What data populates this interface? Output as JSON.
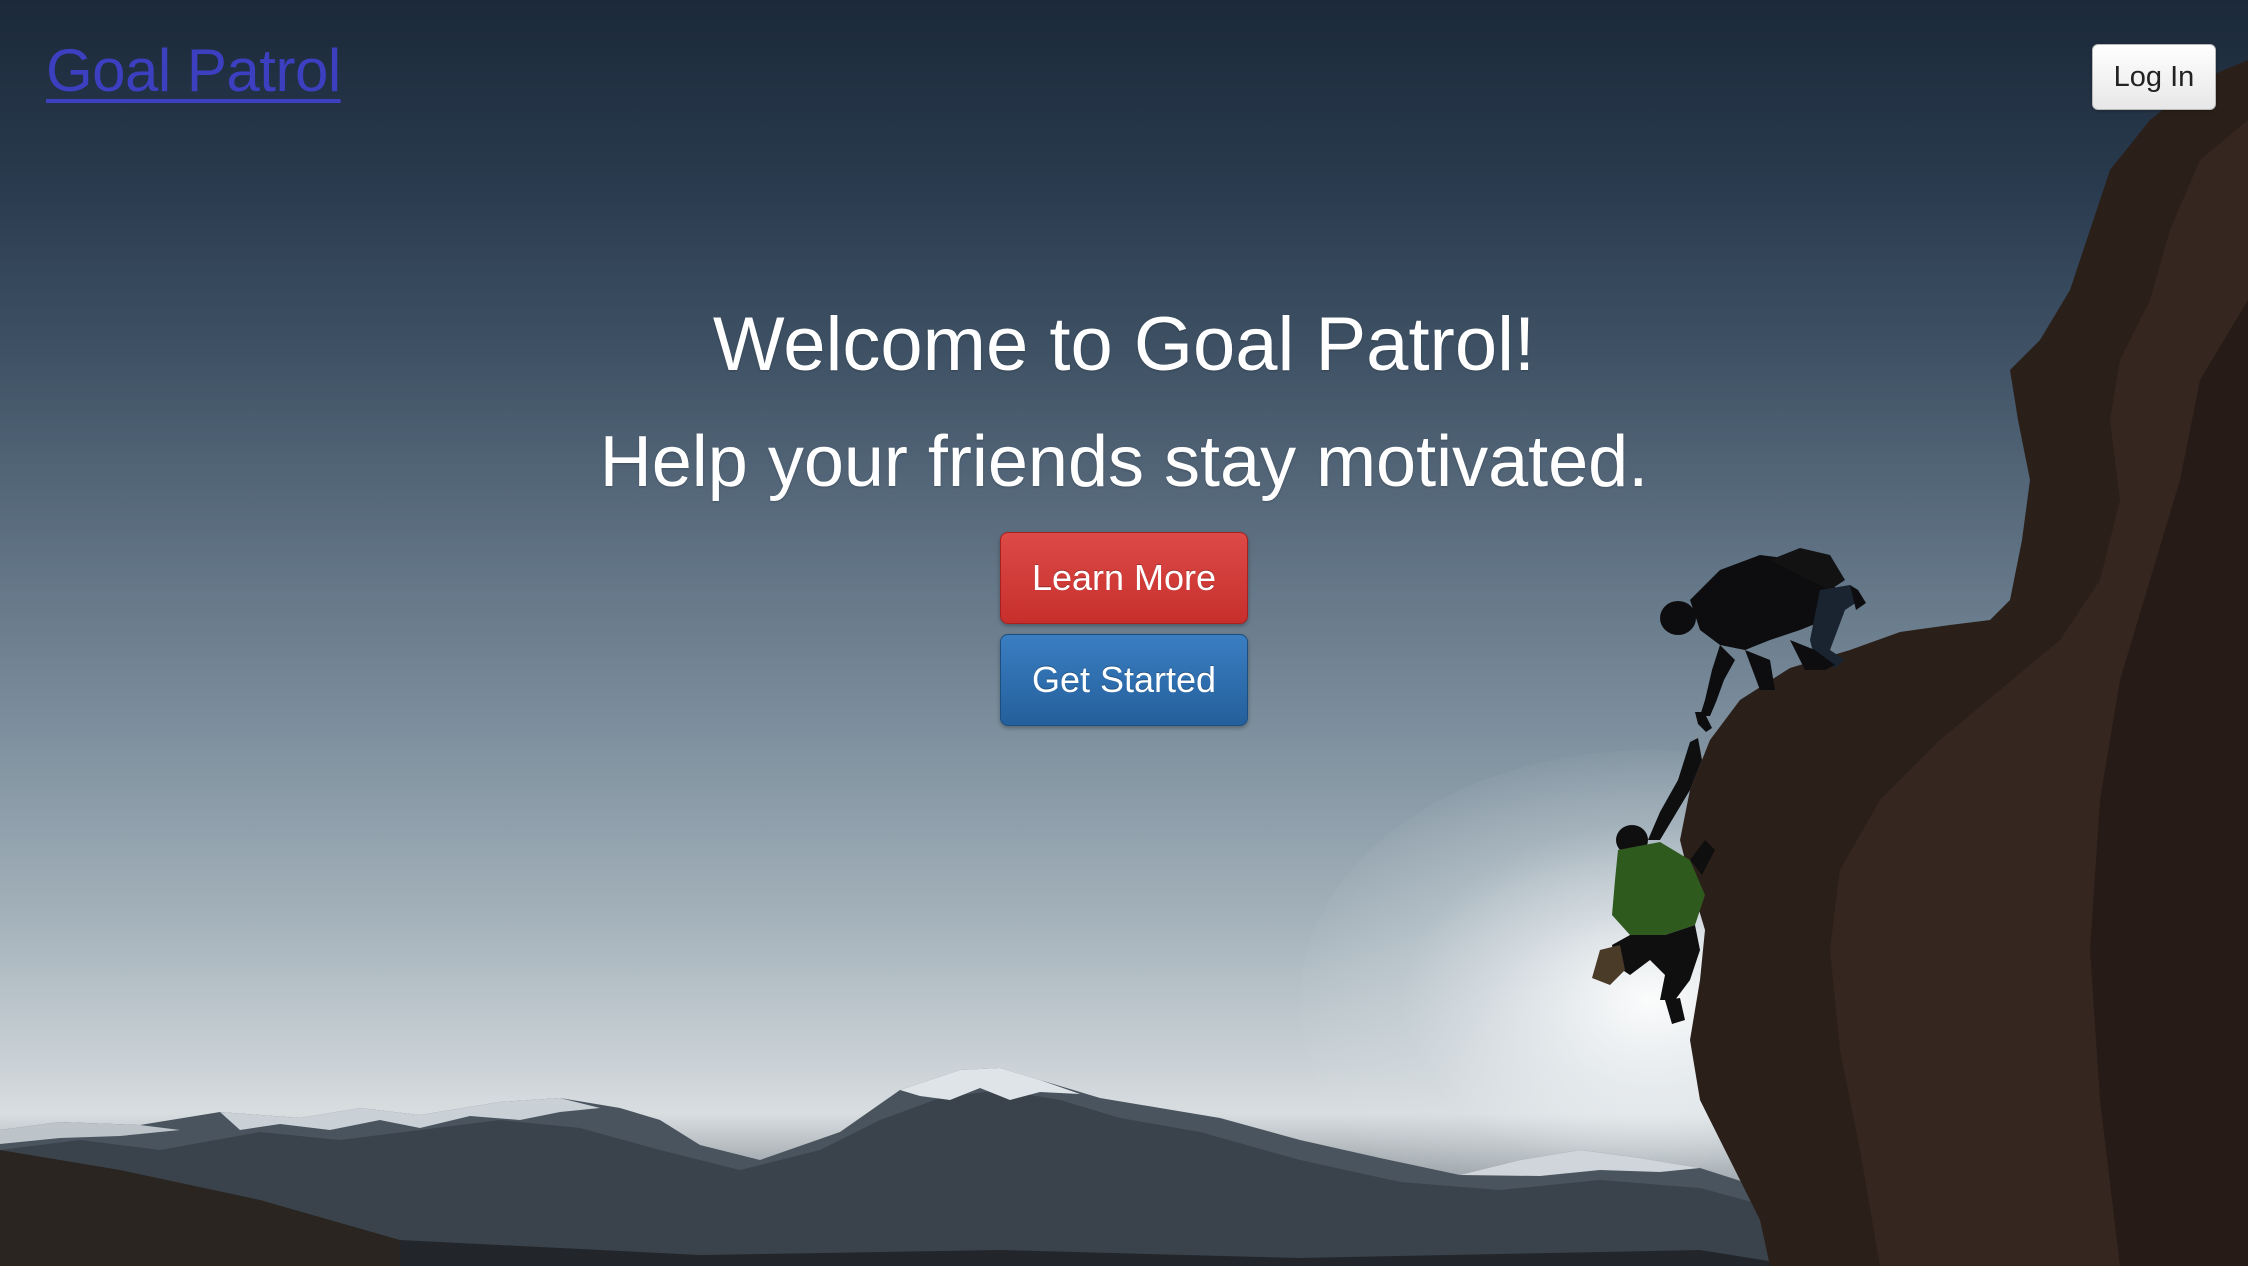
{
  "header": {
    "brand": "Goal Patrol",
    "login_label": "Log In"
  },
  "hero": {
    "title": "Welcome to Goal Patrol!",
    "subtitle": "Help your friends stay motivated."
  },
  "actions": {
    "learn_more_label": "Learn More",
    "get_started_label": "Get Started"
  },
  "colors": {
    "brand_link": "#3b3fc0",
    "learn_more": "#d33f3c",
    "get_started": "#2f6eae"
  }
}
